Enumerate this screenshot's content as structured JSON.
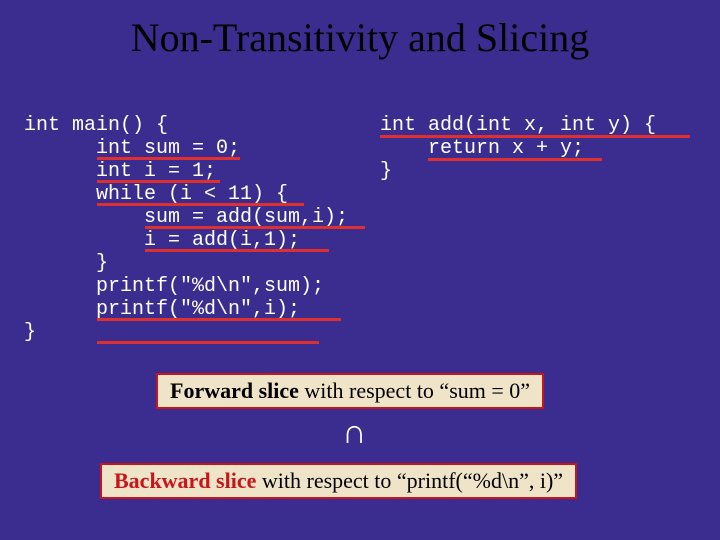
{
  "title": "Non-Transitivity and Slicing",
  "code_left": "int main() {\n      int sum = 0;\n      int i = 1;\n      while (i < 11) {\n          sum = add(sum,i);\n          i = add(i,1);\n      }\n      printf(\"%d\\n\",sum);\n      printf(\"%d\\n\",i);\n}",
  "code_right": "int add(int x, int y) {\n    return x + y;\n}",
  "fwd_bold": "Forward slice",
  "fwd_rest": " with respect to “sum = 0”",
  "bwd_bold": "Backward slice",
  "bwd_rest": " with respect to “printf(“%d\\n”, i)”",
  "intersect_glyph": "∩"
}
